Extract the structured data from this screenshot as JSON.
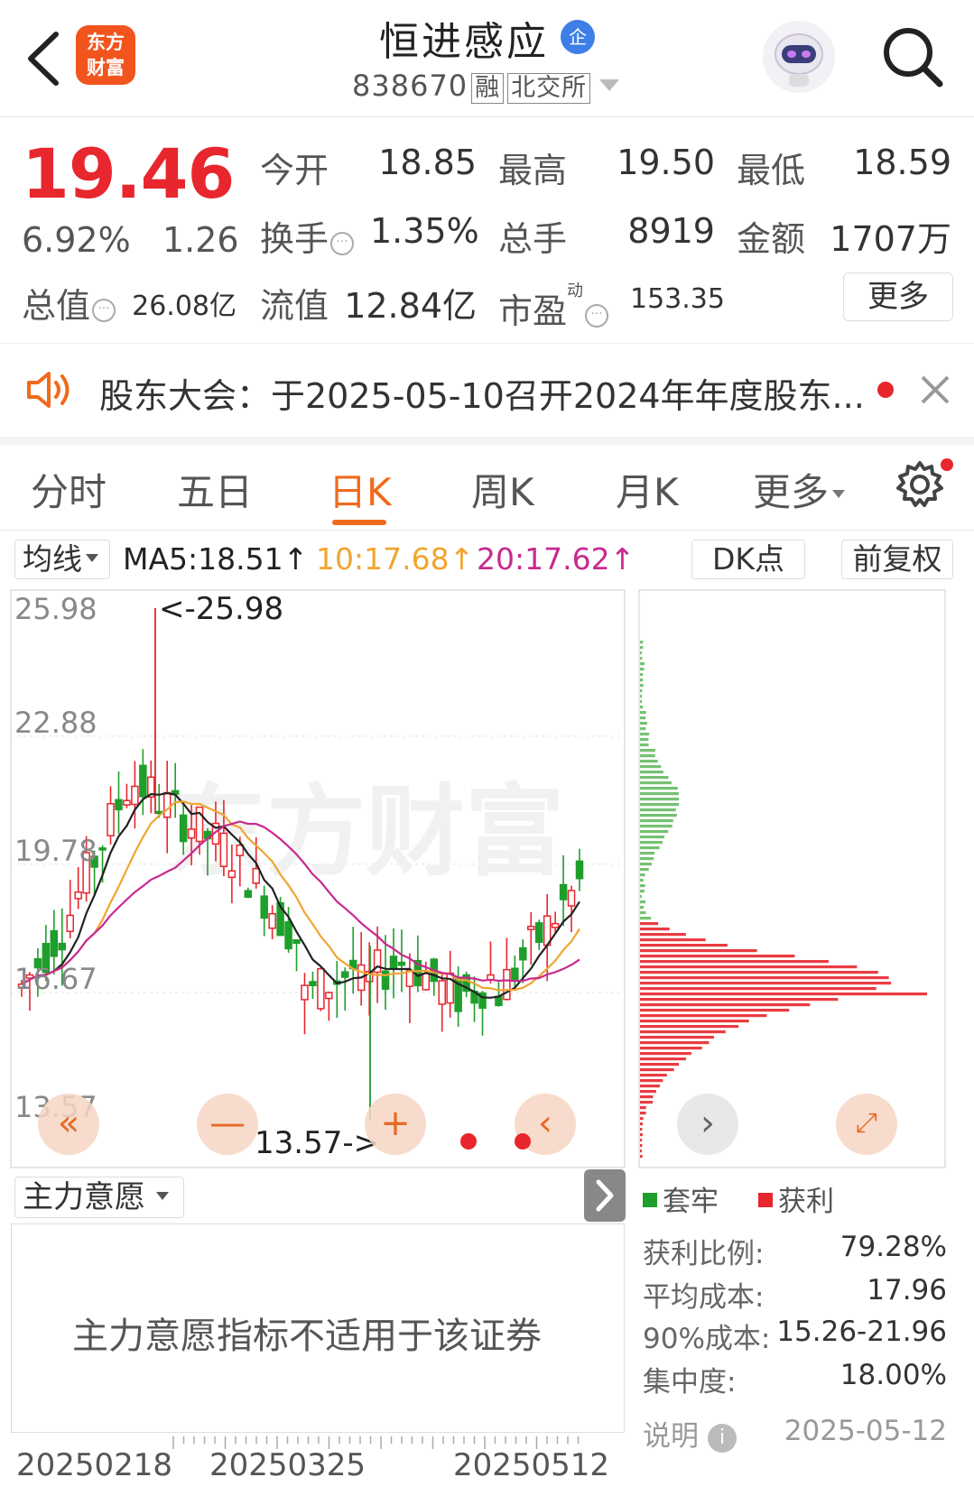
{
  "header": {
    "app_logo_line1": "东方",
    "app_logo_line2": "财富",
    "stock_name": "恒进感应",
    "ent_badge": "企",
    "stock_code": "838670",
    "tag_margin": "融",
    "tag_exchange": "北交所"
  },
  "quote": {
    "price": "19.46",
    "change_pct": "6.92%",
    "change_amt": "1.26",
    "open_label": "今开",
    "open": "18.85",
    "high_label": "最高",
    "high": "19.50",
    "low_label": "最低",
    "low": "18.59",
    "turnover_label": "换手",
    "turnover": "1.35%",
    "volume_label": "总手",
    "volume": "8919",
    "amount_label": "金额",
    "amount": "1707万",
    "mktcap_label": "总值",
    "mktcap": "26.08亿",
    "float_label": "流值",
    "float_cap": "12.84亿",
    "pe_label": "市盈",
    "pe_sup": "动",
    "pe": "153.35",
    "more_label": "更多"
  },
  "notice": {
    "text": "股东大会：于2025-05-10召开2024年年度股东..."
  },
  "tabs": {
    "items": [
      "分时",
      "五日",
      "日K",
      "周K",
      "月K",
      "更多"
    ],
    "active": "日K"
  },
  "ma_bar": {
    "select_label": "均线",
    "ma5": "MA5:18.51↑",
    "ma10": "10:17.68↑",
    "ma20": "20:17.62↑",
    "dk_label": "DK点",
    "adjust_label": "前复权"
  },
  "colors": {
    "up": "#e8262d",
    "down": "#1e9e2b",
    "ma5": "#222222",
    "ma10": "#f0a531",
    "ma20": "#c8298f",
    "accent": "#f06a1b"
  },
  "chart_data": {
    "type": "candlestick",
    "y_ticks": [
      "25.98",
      "22.88",
      "19.78",
      "16.67",
      "13.57"
    ],
    "ylim": [
      13.57,
      25.98
    ],
    "max_label": "<-25.98",
    "min_label": "13.57->",
    "x_labels": [
      "20250218",
      "20250325",
      "20250512"
    ]
  },
  "chip": {
    "legend_loss": "套牢",
    "legend_profit": "获利",
    "profit_ratio_label": "获利比例:",
    "profit_ratio": "79.28%",
    "avg_cost_label": "平均成本:",
    "avg_cost": "17.96",
    "cost90_label": "90%成本:",
    "cost90": "15.26-21.96",
    "concentration_label": "集中度:",
    "concentration": "18.00%",
    "note_label": "说明",
    "date": "2025-05-12"
  },
  "main_force": {
    "select_label": "主力意愿",
    "message": "主力意愿指标不适用于该证券"
  }
}
